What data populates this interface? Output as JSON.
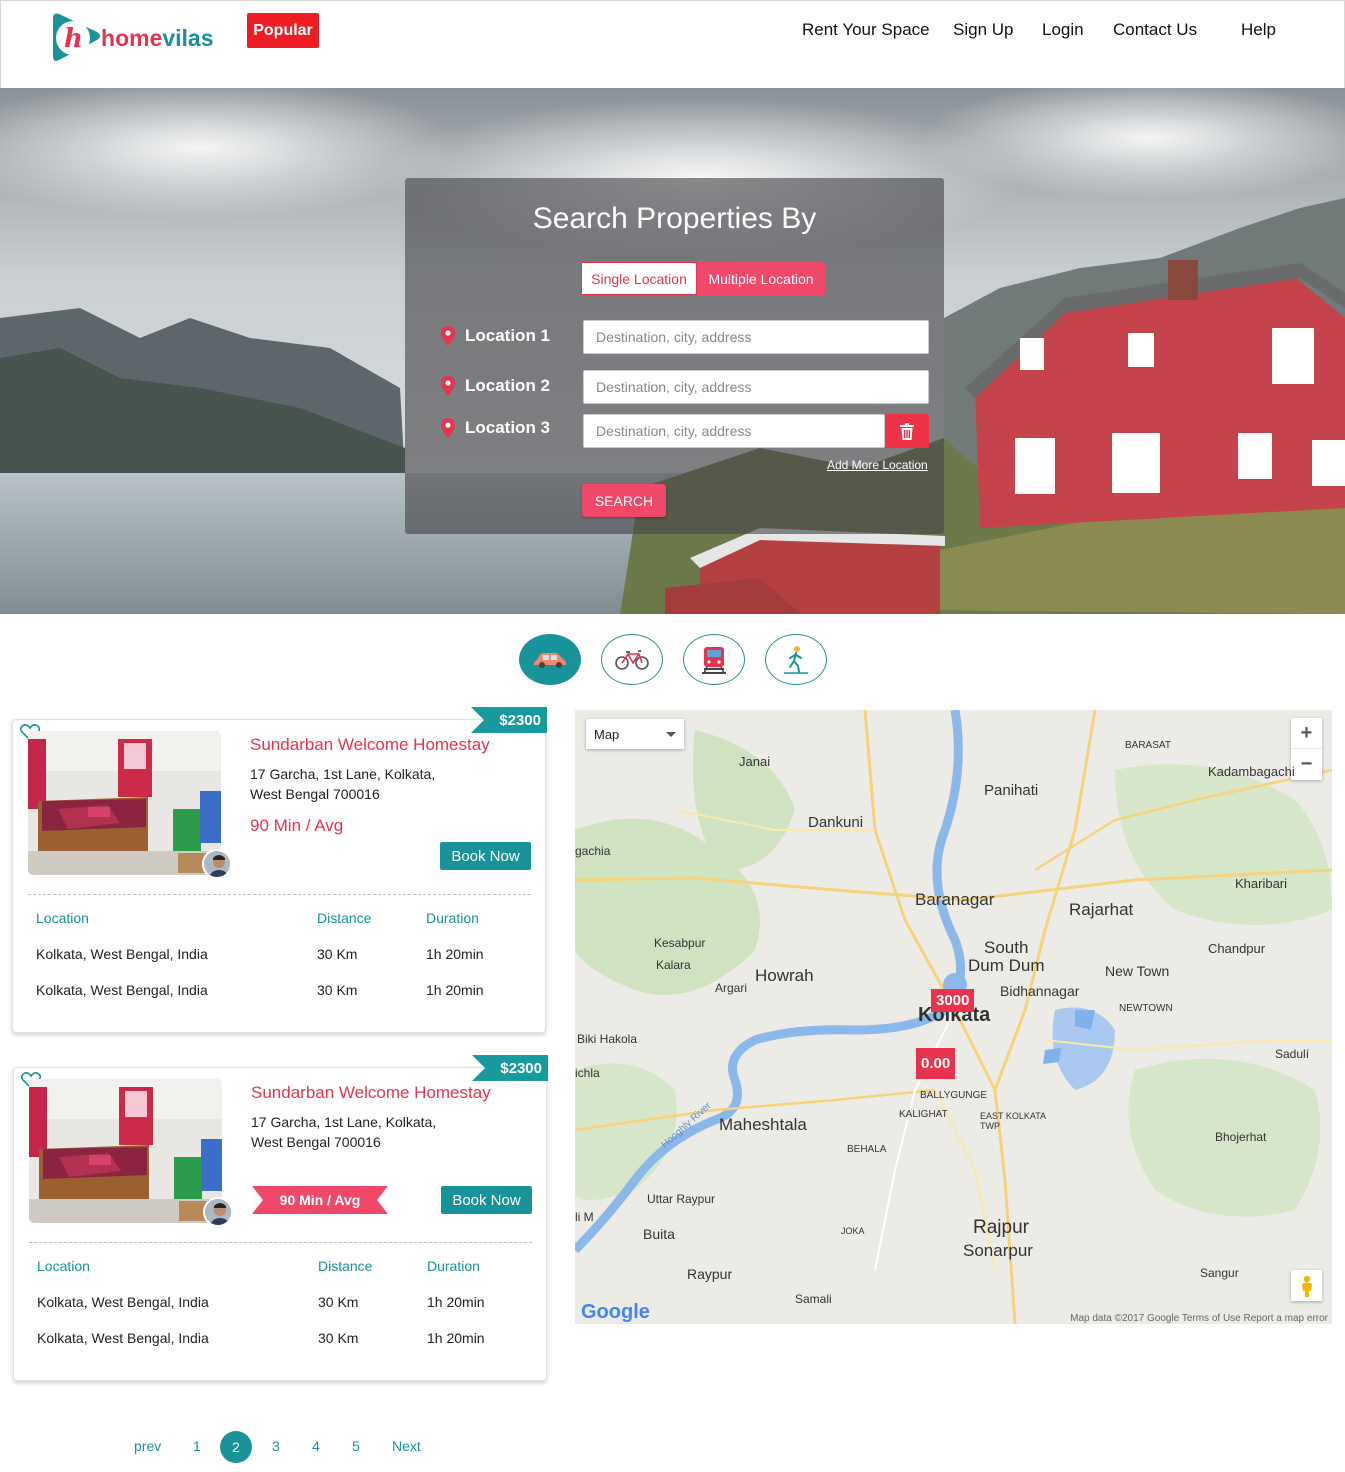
{
  "header": {
    "logo_text_a": "h",
    "logo_text_b": "ome",
    "logo_text_c": "vilas",
    "popular_label": "Popular",
    "nav": [
      "Rent Your Space",
      "Sign Up",
      "Login",
      "Contact Us",
      "Help"
    ]
  },
  "search": {
    "title": "Search Properties By",
    "toggle_single": "Single Location",
    "toggle_multiple": "Multiple Location",
    "locations": [
      {
        "label": "Location 1",
        "placeholder": "Destination, city, address"
      },
      {
        "label": "Location 2",
        "placeholder": "Destination, city, address"
      },
      {
        "label": "Location 3",
        "placeholder": "Destination, city, address"
      }
    ],
    "add_more": "Add More Location",
    "search_button": "SEARCH"
  },
  "modes": [
    "car-icon",
    "bicycle-icon",
    "train-icon",
    "walking-icon"
  ],
  "listings": [
    {
      "price": "$2300",
      "title": "Sundarban Welcome Homestay",
      "address_line1": "17 Garcha, 1st Lane, Kolkata,",
      "address_line2": "West Bengal 700016",
      "avg": "90 Min / Avg",
      "book_label": "Book Now",
      "table_headers": [
        "Location",
        "Distance",
        "Duration"
      ],
      "rows": [
        [
          "Kolkata, West Bengal, India",
          "30 Km",
          "1h 20min"
        ],
        [
          "Kolkata, West Bengal, India",
          "30 Km",
          "1h 20min"
        ]
      ]
    },
    {
      "price": "$2300",
      "title": "Sundarban Welcome Homestay",
      "address_line1": "17 Garcha, 1st Lane, Kolkata,",
      "address_line2": "West Bengal 700016",
      "avg": "90 Min / Avg",
      "book_label": "Book Now",
      "table_headers": [
        "Location",
        "Distance",
        "Duration"
      ],
      "rows": [
        [
          "Kolkata, West Bengal, India",
          "30 Km",
          "1h 20min"
        ],
        [
          "Kolkata, West Bengal, India",
          "30 Km",
          "1h 20min"
        ]
      ]
    }
  ],
  "map": {
    "type_label": "Map",
    "zoom_in": "+",
    "zoom_out": "−",
    "markers": [
      "3000",
      "0.00"
    ],
    "places": [
      "Janai",
      "Dankuni",
      "Panihati",
      "BARASAT",
      "Kadambagachi",
      "Baranagar",
      "Rajarhat",
      "Kharibari",
      "South",
      "Dum Dum",
      "Bidhannagar",
      "Kesabpur",
      "Kalara",
      "Howrah",
      "Argari",
      "New Town",
      "Chandpur",
      "NEWTOWN",
      "Kolkata",
      "Biki Hakola",
      "Sadulí",
      "BALLYGUNGE",
      "KALIGHAT",
      "EAST KOLKATA TWP",
      "BEHALA",
      "Maheshtala",
      "Bhojerhat",
      "Uttar Raypur",
      "Buita",
      "JOKA",
      "Rajpur",
      "Sonarpur",
      "Raypur",
      "Samali",
      "Sangur",
      "gachia",
      "ichla",
      "li M"
    ],
    "river_label": "Hooghly River",
    "google": "Google",
    "footer": "Map data ©2017 Google    Terms of Use    Report a map error"
  },
  "pagination": {
    "prev": "prev",
    "pages": [
      "1",
      "2",
      "3",
      "4",
      "5"
    ],
    "active": "2",
    "next": "Next"
  },
  "colors": {
    "accent_red": "#e8334f",
    "accent_teal": "#18939a",
    "popular_red": "#ee1d23"
  }
}
